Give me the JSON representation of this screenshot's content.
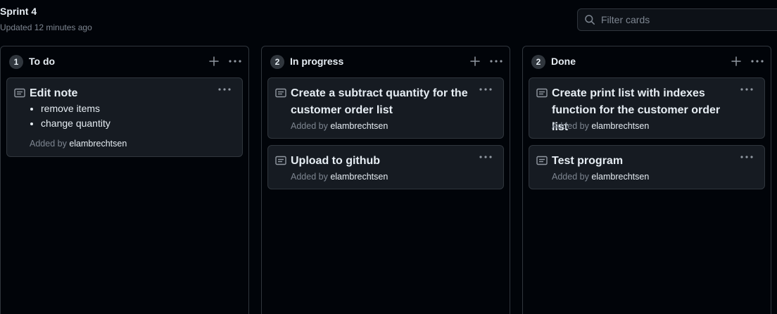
{
  "board": {
    "title": "Sprint 4",
    "subtitle": "Updated 12 minutes ago"
  },
  "filter": {
    "placeholder": "Filter cards"
  },
  "columns": [
    {
      "count": "1",
      "name": "To do",
      "cards": [
        {
          "title": "Edit note",
          "items": [
            "remove items",
            "change quantity"
          ],
          "added_by_label": "Added by",
          "author": "elambrechtsen"
        }
      ]
    },
    {
      "count": "2",
      "name": "In progress",
      "cards": [
        {
          "title": "Create a subtract quantity for the customer order list",
          "added_by_label": "Added by",
          "author": "elambrechtsen"
        },
        {
          "title": "Upload to github",
          "added_by_label": "Added by",
          "author": "elambrechtsen"
        }
      ]
    },
    {
      "count": "2",
      "name": "Done",
      "cards": [
        {
          "title": "Create print list with indexes function for the customer order list",
          "added_by_label": "Added by",
          "author": "elambrechtsen"
        },
        {
          "title": "Test program",
          "added_by_label": "Added by",
          "author": "elambrechtsen"
        }
      ]
    }
  ],
  "icons": {
    "add": "plus-icon",
    "more": "kebab-horizontal-icon",
    "note": "note-icon",
    "search": "search-icon"
  },
  "colors": {
    "background": "#010409",
    "card": "#161b22",
    "border": "#30363d",
    "muted_text": "#7d8590",
    "text": "#e6edf3"
  }
}
